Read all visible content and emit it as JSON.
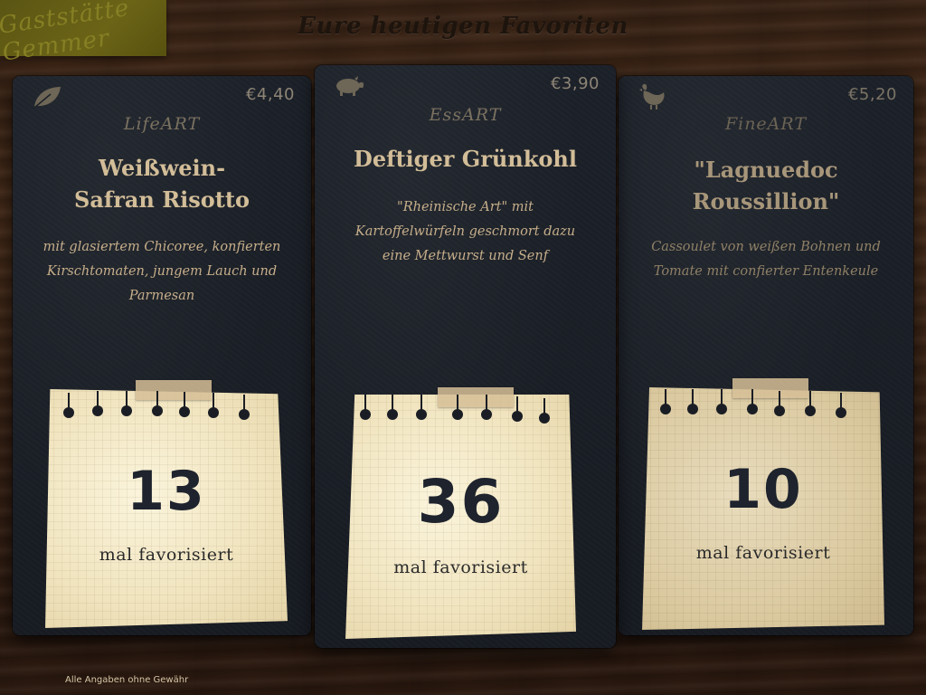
{
  "logo": {
    "text": "Gaststätte Gemmer"
  },
  "page": {
    "title": "Eure heutigen Favoriten"
  },
  "cards": [
    {
      "icon": "leaf-icon",
      "price": "€4,40",
      "category": "LifeART",
      "dish_line1": "Weißwein-",
      "dish_line2": "Safran Risotto",
      "desc_line1": "mit glasiertem Chicoree, konfierten",
      "desc_line2": "Kirschtomaten, jungem Lauch und",
      "desc_line3": "Parmesan",
      "count": "13",
      "count_label": "mal favorisiert"
    },
    {
      "icon": "pig-icon",
      "price": "€3,90",
      "category": "EssART",
      "dish_line1": "Deftiger Grünkohl",
      "dish_line2": "",
      "desc_line1": "\"Rheinische Art\" mit",
      "desc_line2": "Kartoffelwürfeln geschmort dazu",
      "desc_line3": "eine Mettwurst und Senf",
      "count": "36",
      "count_label": "mal favorisiert"
    },
    {
      "icon": "chicken-icon",
      "price": "€5,20",
      "category": "FineART",
      "dish_line1": "\"Lagnuedoc",
      "dish_line2": "Roussillion\"",
      "desc_line1": "Cassoulet von weißen Bohnen und",
      "desc_line2": "Tomate mit confierter Entenkeule",
      "desc_line3": "",
      "count": "10",
      "count_label": "mal favorisiert"
    }
  ],
  "footer": {
    "disclaimer": "Alle Angaben ohne Gewähr"
  }
}
